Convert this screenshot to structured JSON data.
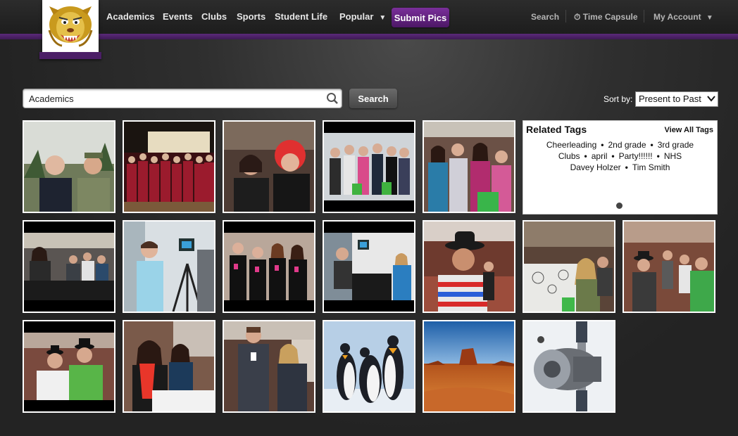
{
  "nav": {
    "items": [
      "Academics",
      "Events",
      "Clubs",
      "Sports",
      "Student Life"
    ],
    "popular_label": "Popular",
    "popular_caret": "▼",
    "submit_label": "Submit Pics"
  },
  "utility": {
    "search_label": "Search",
    "time_capsule_label": "Time Capsule",
    "time_capsule_icon": "⏱",
    "account_label": "My Account",
    "account_caret": "▼"
  },
  "search": {
    "value": "Academics",
    "button_label": "Search"
  },
  "sort": {
    "label": "Sort by:",
    "selected": "Present to Past"
  },
  "related_tags": {
    "title": "Related Tags",
    "view_all": "View All Tags",
    "tags": [
      "Cheerleading",
      "2nd grade",
      "3rd grade",
      "Clubs",
      "april",
      "Party!!!!!!",
      "NHS",
      "Davey Holzer",
      "Tim Smith"
    ],
    "separator": "•"
  },
  "colors": {
    "brand_purple": "#5b2a7a",
    "submit_button": "#7a2f9a",
    "background": "#262626"
  }
}
